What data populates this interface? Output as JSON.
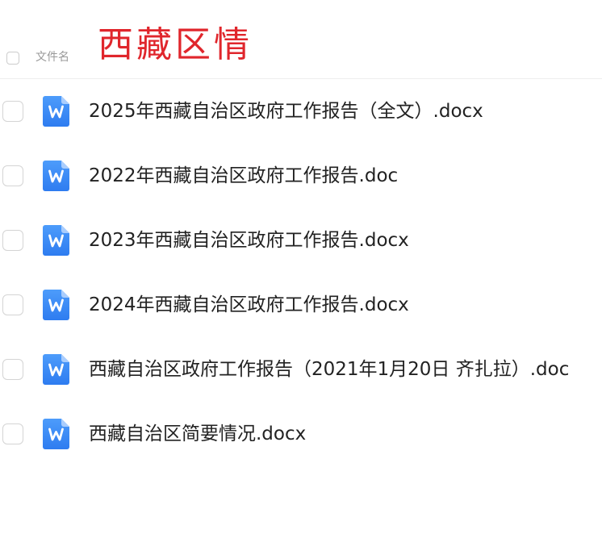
{
  "header": {
    "column_label": "文件名"
  },
  "overlay": {
    "title": "西藏区情",
    "color": "#e0262c"
  },
  "files": [
    {
      "name": "2025年西藏自治区政府工作报告（全文）.docx",
      "icon": "word-doc-icon"
    },
    {
      "name": "2022年西藏自治区政府工作报告.doc",
      "icon": "word-doc-icon"
    },
    {
      "name": "2023年西藏自治区政府工作报告.docx",
      "icon": "word-doc-icon"
    },
    {
      "name": "2024年西藏自治区政府工作报告.docx",
      "icon": "word-doc-icon"
    },
    {
      "name": "西藏自治区政府工作报告（2021年1月20日 齐扎拉）.doc",
      "icon": "word-doc-icon"
    },
    {
      "name": "西藏自治区简要情况.docx",
      "icon": "word-doc-icon"
    }
  ],
  "colors": {
    "icon_top": "#4d9cfb",
    "icon_bottom": "#2e7cf0",
    "text": "#222222"
  }
}
